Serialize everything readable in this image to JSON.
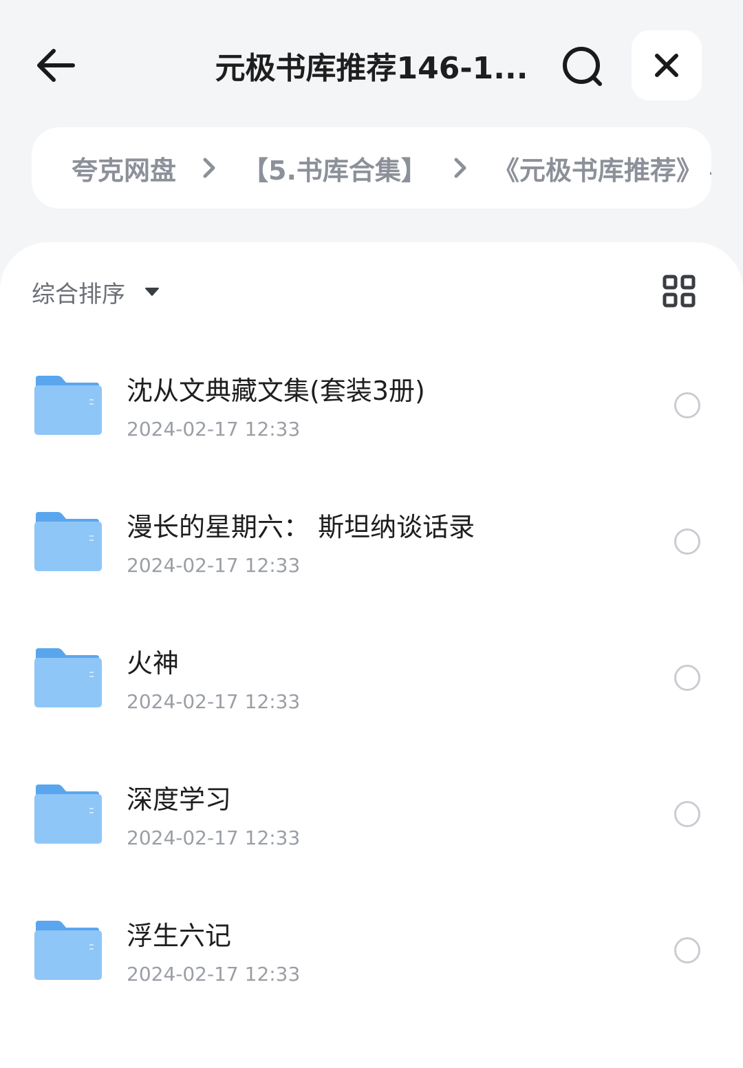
{
  "header": {
    "title": "元极书库推荐146-1...",
    "back_icon": "arrow-left-icon",
    "search_icon": "search-icon",
    "close_icon": "close-icon"
  },
  "breadcrumb": {
    "items": [
      "夸克网盘",
      "【5.书库合集】",
      "《元极书库推荐》"
    ],
    "overflow": "."
  },
  "toolbar": {
    "sort_label": "综合排序",
    "sort_icon": "caret-down-icon",
    "view_icon": "grid-view-icon"
  },
  "files": [
    {
      "name": "沈从文典藏文集(套装3册)",
      "date": "2024-02-17 12:33"
    },
    {
      "name": "漫长的星期六：  斯坦纳谈话录",
      "date": "2024-02-17 12:33"
    },
    {
      "name": "火神",
      "date": "2024-02-17 12:33"
    },
    {
      "name": "深度学习",
      "date": "2024-02-17 12:33"
    },
    {
      "name": "浮生六记",
      "date": "2024-02-17 12:33"
    }
  ],
  "colors": {
    "background": "#f4f5f7",
    "panel": "#ffffff",
    "folder": "#6fb4f2",
    "muted_text": "#8c9099"
  }
}
